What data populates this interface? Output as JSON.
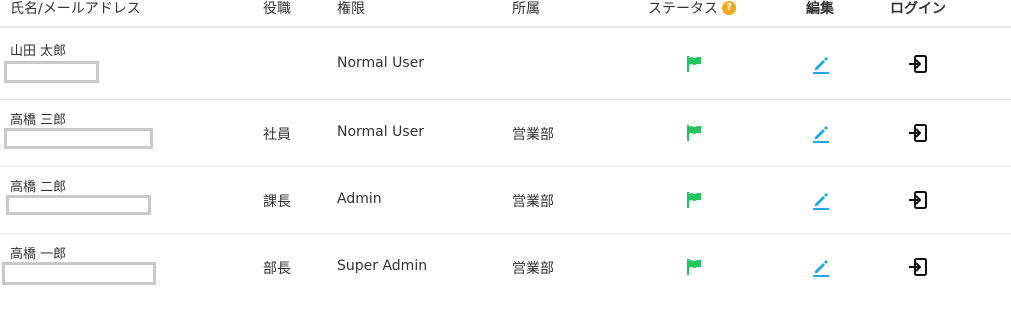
{
  "header": {
    "name_email": "氏名/メールアドレス",
    "position": "役職",
    "permission": "権限",
    "department": "所属",
    "status": "ステータス",
    "status_help": "?",
    "edit": "編集",
    "login": "ログイン"
  },
  "rows": [
    {
      "name": "山田 太郎",
      "position": "",
      "permission": "Normal User",
      "department": "",
      "status_icon": "flag-icon",
      "edit_icon": "edit-icon",
      "login_icon": "login-icon"
    },
    {
      "name": "高橋 三郎",
      "position": "社員",
      "permission": "Normal User",
      "department": "営業部",
      "status_icon": "flag-icon",
      "edit_icon": "edit-icon",
      "login_icon": "login-icon"
    },
    {
      "name": "高橋 二郎",
      "position": "課長",
      "permission": "Admin",
      "department": "営業部",
      "status_icon": "flag-icon",
      "edit_icon": "edit-icon",
      "login_icon": "login-icon"
    },
    {
      "name": "高橋 一郎",
      "position": "部長",
      "permission": "Super Admin",
      "department": "営業部",
      "status_icon": "flag-icon",
      "edit_icon": "edit-icon",
      "login_icon": "login-icon"
    }
  ],
  "colors": {
    "flag": "#22c55e",
    "edit": "#1ea7e1",
    "help": "#f5a623",
    "redact_border": "#c9c9c9"
  }
}
